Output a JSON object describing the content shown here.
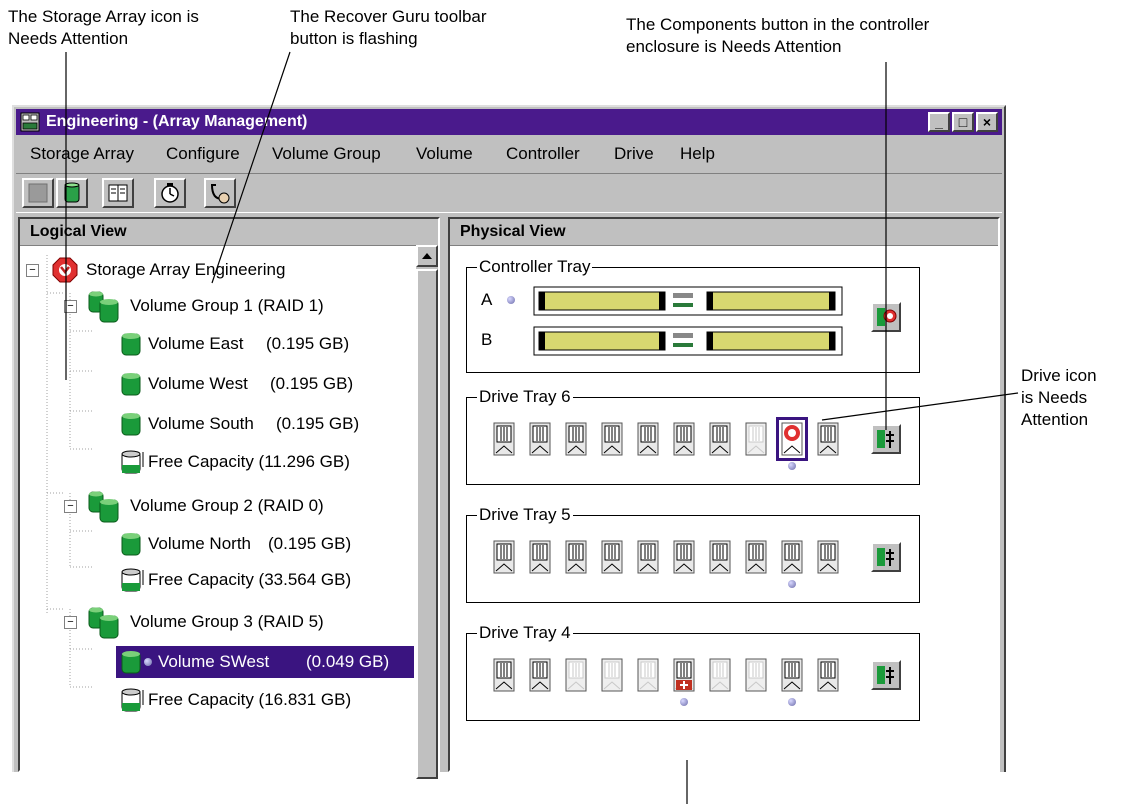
{
  "callouts": {
    "storage_array_icon": "The Storage Array icon is\nNeeds Attention",
    "recover_guru": "The Recover Guru toolbar\nbutton is flashing",
    "components_button": "The Components button in the controller\nenclosure is Needs Attention",
    "drive_icon": "Drive icon\nis Needs\nAttention"
  },
  "window": {
    "title": "Engineering - (Array Management)",
    "controls": [
      "_",
      "□",
      "×"
    ]
  },
  "menu": {
    "storage_array": "Storage Array",
    "configure": "Configure",
    "volume_group": "Volume Group",
    "volume": "Volume",
    "controller": "Controller",
    "drive": "Drive",
    "help": "Help"
  },
  "toolbar": {
    "icons": [
      "array-management-icon",
      "storage-icon",
      "book-icon",
      "timer-icon",
      "recover-guru-icon"
    ]
  },
  "logical_view": {
    "header": "Logical View",
    "root": "Storage Array Engineering",
    "vg1": "Volume Group 1 (RAID 1)",
    "vol_east": "Volume East",
    "vol_east_size": "(0.195 GB)",
    "vol_west": "Volume West",
    "vol_west_size": "(0.195 GB)",
    "vol_south": "Volume South",
    "vol_south_size": "(0.195 GB)",
    "free1": "Free Capacity (11.296 GB)",
    "vg2": "Volume Group 2 (RAID 0)",
    "vol_north": "Volume North",
    "vol_north_size": "(0.195 GB)",
    "free2": "Free Capacity (33.564 GB)",
    "vg3": "Volume Group 3 (RAID 5)",
    "vol_swest": "Volume SWest",
    "vol_swest_size": "(0.049 GB)",
    "free3": "Free Capacity (16.831 GB)"
  },
  "physical_view": {
    "header": "Physical View",
    "controller_tray": "Controller Tray",
    "controller_a": "A",
    "controller_b": "B",
    "tray6": "Drive Tray 6",
    "tray5": "Drive Tray 5",
    "tray4": "Drive Tray 4"
  },
  "colors": {
    "titlebar": "#4a1a8c",
    "selection": "#3a1480",
    "needs_attention": "#d02020",
    "volume_green": "#1a9a3a"
  }
}
